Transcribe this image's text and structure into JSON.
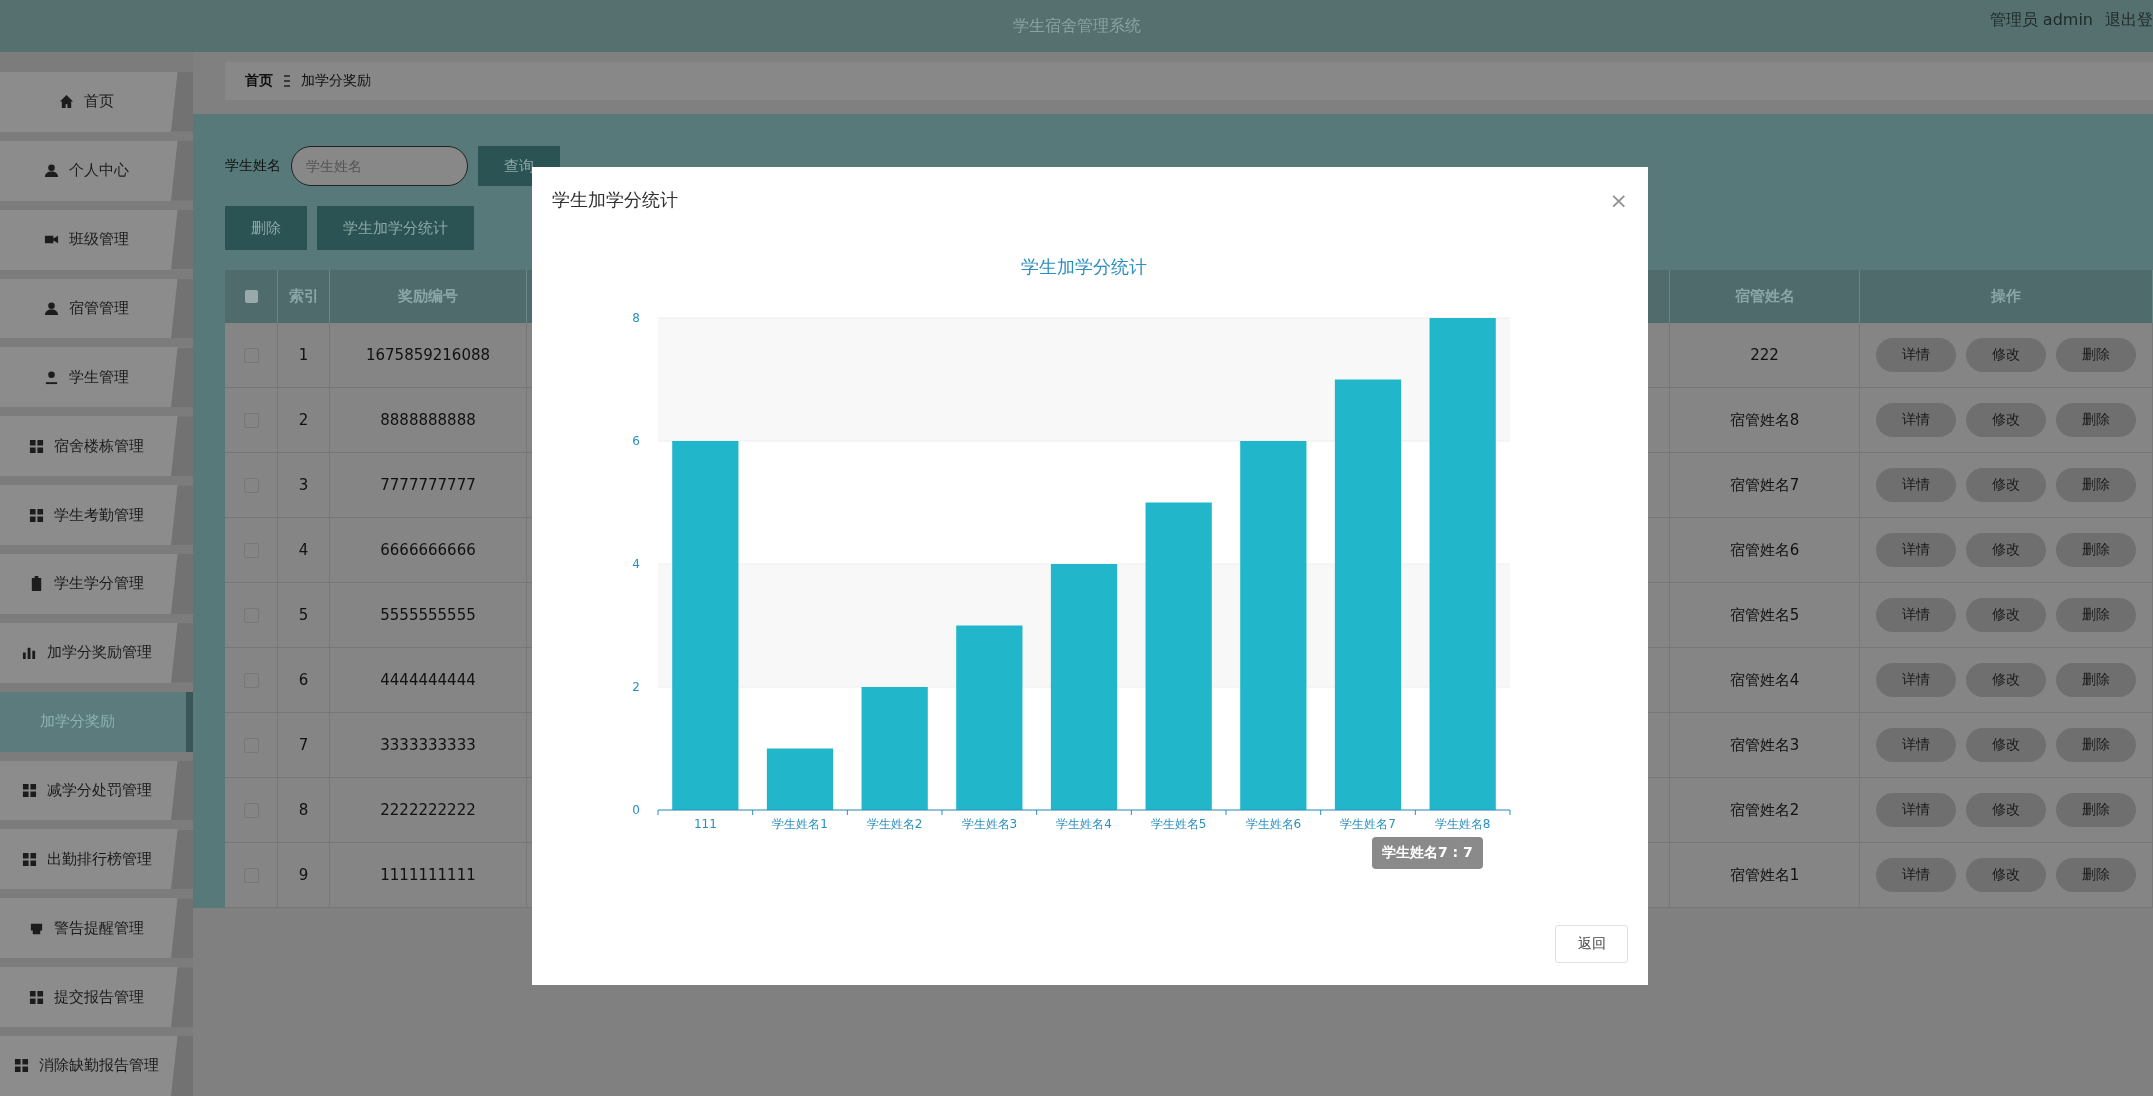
{
  "header": {
    "title": "学生宿舍管理系统",
    "user": "管理员 admin",
    "logout": "退出登"
  },
  "sidebar": {
    "items": [
      {
        "label": "首页",
        "kind": "menu",
        "selected": false
      },
      {
        "label": "个人中心",
        "kind": "menu",
        "selected": false
      },
      {
        "label": "班级管理",
        "kind": "menu",
        "selected": false
      },
      {
        "label": "宿管管理",
        "kind": "menu",
        "selected": false
      },
      {
        "label": "学生管理",
        "kind": "menu",
        "selected": false
      },
      {
        "label": "宿舍楼栋管理",
        "kind": "menu",
        "selected": false
      },
      {
        "label": "学生考勤管理",
        "kind": "menu",
        "selected": false
      },
      {
        "label": "学生学分管理",
        "kind": "menu",
        "selected": false
      },
      {
        "label": "加学分奖励管理",
        "kind": "menu",
        "selected": false
      },
      {
        "label": "加学分奖励",
        "kind": "submenu",
        "selected": true
      },
      {
        "label": "减学分处罚管理",
        "kind": "menu",
        "selected": false
      },
      {
        "label": "出勤排行榜管理",
        "kind": "menu",
        "selected": false
      },
      {
        "label": "警告提醒管理",
        "kind": "menu",
        "selected": false
      },
      {
        "label": "提交报告管理",
        "kind": "menu",
        "selected": false
      },
      {
        "label": "消除缺勤报告管理",
        "kind": "menu",
        "selected": false
      }
    ]
  },
  "breadcrumb": [
    "首页",
    "加学分奖励"
  ],
  "search": {
    "label": "学生姓名",
    "placeholder": "学生姓名",
    "button": "查询"
  },
  "actions": [
    "删除",
    "学生加学分统计"
  ],
  "table": {
    "all_checked": false,
    "columns": [
      "索引",
      "奖励编号",
      "宿管姓名",
      "操作"
    ],
    "rows": [
      {
        "index": "1",
        "number": "1675859216088",
        "manager": "222",
        "checked": false,
        "buttons": [
          "详情",
          "修改",
          "删除"
        ]
      },
      {
        "index": "2",
        "number": "8888888888",
        "manager": "宿管姓名8",
        "checked": false,
        "buttons": [
          "详情",
          "修改",
          "删除"
        ]
      },
      {
        "index": "3",
        "number": "7777777777",
        "manager": "宿管姓名7",
        "checked": false,
        "buttons": [
          "详情",
          "修改",
          "删除"
        ]
      },
      {
        "index": "4",
        "number": "6666666666",
        "manager": "宿管姓名6",
        "checked": false,
        "buttons": [
          "详情",
          "修改",
          "删除"
        ]
      },
      {
        "index": "5",
        "number": "5555555555",
        "manager": "宿管姓名5",
        "checked": false,
        "buttons": [
          "详情",
          "修改",
          "删除"
        ]
      },
      {
        "index": "6",
        "number": "4444444444",
        "manager": "宿管姓名4",
        "checked": false,
        "buttons": [
          "详情",
          "修改",
          "删除"
        ]
      },
      {
        "index": "7",
        "number": "3333333333",
        "manager": "宿管姓名3",
        "checked": false,
        "buttons": [
          "详情",
          "修改",
          "删除"
        ]
      },
      {
        "index": "8",
        "number": "2222222222",
        "manager": "宿管姓名2",
        "checked": false,
        "buttons": [
          "详情",
          "修改",
          "删除"
        ]
      },
      {
        "index": "9",
        "number": "1111111111",
        "manager": "宿管姓名1",
        "checked": false,
        "buttons": [
          "详情",
          "修改",
          "删除"
        ]
      }
    ]
  },
  "dialog": {
    "title": "学生加学分统计",
    "close": "×",
    "button": "返回",
    "tooltip": "学生姓名7 : 7",
    "chart_data": {
      "type": "bar",
      "title": "学生加学分统计",
      "categories": [
        "111",
        "学生姓名1",
        "学生姓名2",
        "学生姓名3",
        "学生姓名4",
        "学生姓名5",
        "学生姓名6",
        "学生姓名7",
        "学生姓名8"
      ],
      "values": [
        6,
        1,
        2,
        3,
        4,
        5,
        6,
        7,
        8
      ],
      "ylim": [
        0,
        8
      ],
      "yticks": [
        0,
        2,
        4,
        6,
        8
      ],
      "grid": true
    }
  }
}
